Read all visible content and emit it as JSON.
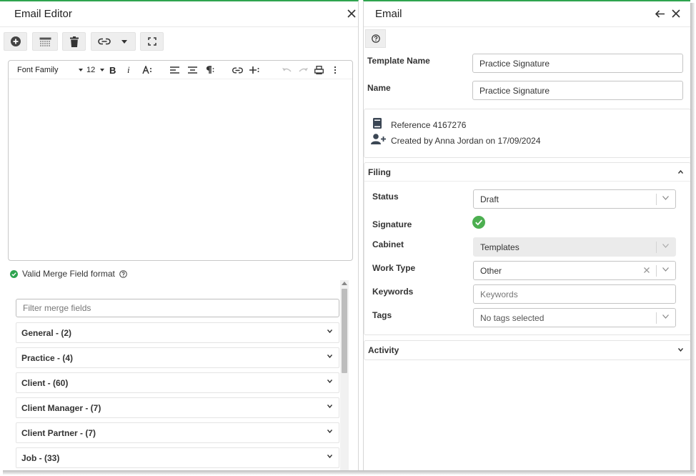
{
  "left": {
    "title": "Email Editor",
    "editor": {
      "font_family": "Font Family",
      "font_size": "12"
    },
    "merge_status": "Valid Merge Field format",
    "filter_placeholder": "Filter merge fields",
    "groups": [
      {
        "label": "General - (2)"
      },
      {
        "label": "Practice - (4)"
      },
      {
        "label": "Client - (60)"
      },
      {
        "label": "Client Manager - (7)"
      },
      {
        "label": "Client Partner - (7)"
      },
      {
        "label": "Job - (33)"
      }
    ]
  },
  "right": {
    "title": "Email",
    "template_name_label": "Template Name",
    "template_name_value": "Practice Signature",
    "name_label": "Name",
    "name_value": "Practice Signature",
    "reference": "Reference 4167276",
    "created_by": "Created by Anna Jordan on 17/09/2024",
    "filing": {
      "title": "Filing",
      "status_label": "Status",
      "status_value": "Draft",
      "signature_label": "Signature",
      "cabinet_label": "Cabinet",
      "cabinet_value": "Templates",
      "work_type_label": "Work Type",
      "work_type_value": "Other",
      "keywords_label": "Keywords",
      "keywords_placeholder": "Keywords",
      "tags_label": "Tags",
      "tags_value": "No tags selected"
    },
    "activity_title": "Activity"
  },
  "colors": {
    "accent_green": "#2ea44f",
    "check_green": "#4caf50",
    "icon_dark": "#3b4654"
  }
}
